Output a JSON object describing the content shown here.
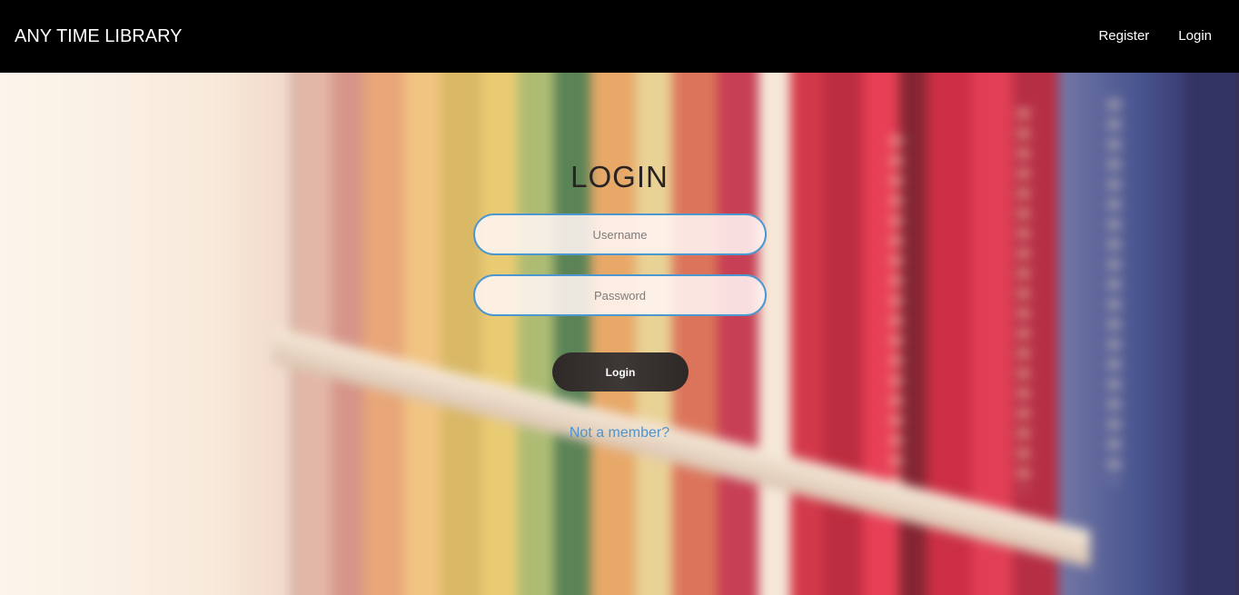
{
  "header": {
    "brand": "ANY TIME LIBRARY",
    "nav": [
      {
        "label": "Register"
      },
      {
        "label": "Login"
      }
    ]
  },
  "login": {
    "title": "LOGIN",
    "username_placeholder": "Username",
    "password_placeholder": "Password",
    "submit_label": "Login",
    "member_link": "Not a member?"
  },
  "colors": {
    "navbar_bg": "#000000",
    "field_border": "#4c97cf",
    "link": "#4e94cf",
    "button_bg": "#36302e"
  }
}
